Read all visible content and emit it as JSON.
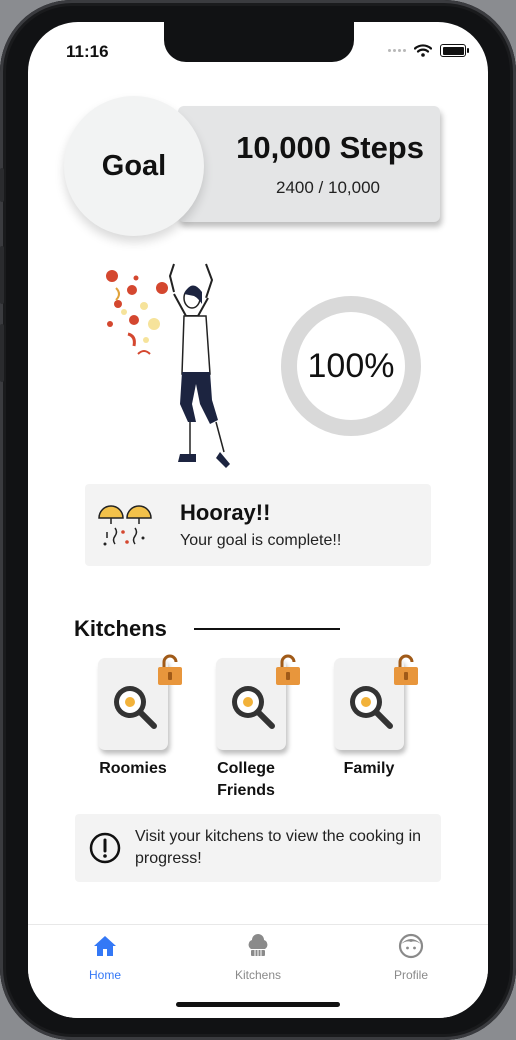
{
  "status_bar": {
    "time": "11:16"
  },
  "goal": {
    "label": "Goal",
    "target": "10,000 Steps",
    "progress": "2400 / 10,000"
  },
  "completion": {
    "percent_text": "100%",
    "percent": 100
  },
  "hooray": {
    "title": "Hooray!!",
    "subtitle": "Your goal is complete!!"
  },
  "kitchens": {
    "title": "Kitchens",
    "items": [
      {
        "label": "Roomies",
        "icon": "frying-pan-icon",
        "lock_icon": "unlocked-padlock-icon"
      },
      {
        "label": "College Friends",
        "icon": "frying-pan-icon",
        "lock_icon": "unlocked-padlock-icon"
      },
      {
        "label": "Family",
        "icon": "frying-pan-icon",
        "lock_icon": "unlocked-padlock-icon"
      }
    ]
  },
  "info": {
    "text": "Visit your kitchens to view the cooking in progress!",
    "icon": "exclamation-circle-icon"
  },
  "tabbar": {
    "tabs": [
      {
        "label": "Home",
        "icon": "home-icon",
        "active": true
      },
      {
        "label": "Kitchens",
        "icon": "chef-hat-icon",
        "active": false
      },
      {
        "label": "Profile",
        "icon": "face-icon",
        "active": false
      }
    ]
  },
  "colors": {
    "accent": "#3478f6",
    "lock": "#e8963c",
    "ring": "#d9d9d9",
    "card": "#e4e5e6"
  }
}
